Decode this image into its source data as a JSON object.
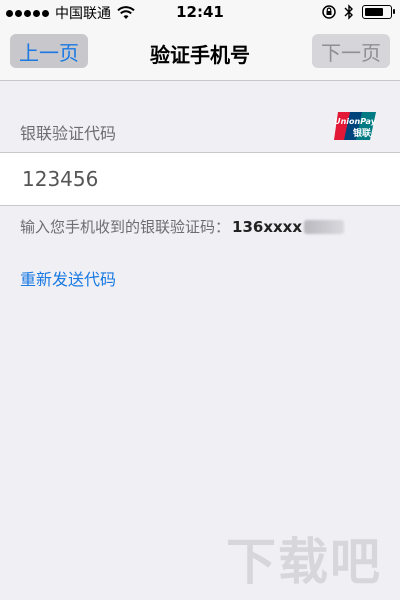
{
  "status_bar": {
    "carrier": "中国联通",
    "time": "12:41",
    "battery_level": 0.8
  },
  "nav": {
    "prev_label": "上一页",
    "title": "验证手机号",
    "next_label": "下一页"
  },
  "form": {
    "section_label": "银联验证代码",
    "code_value": "123456",
    "hint_text": "输入您手机收到的银联验证码：",
    "hint_phone": "136xxxx",
    "resend_label": "重新发送代码"
  },
  "brand": {
    "unionpay_text": "UnionPay",
    "unionpay_cn": "银联"
  },
  "watermark": {
    "text": "下载吧"
  },
  "colors": {
    "accent_blue": "#1a7ae2",
    "unionpay_red": "#e21836",
    "unionpay_blue": "#00447c",
    "unionpay_green": "#007b84"
  }
}
